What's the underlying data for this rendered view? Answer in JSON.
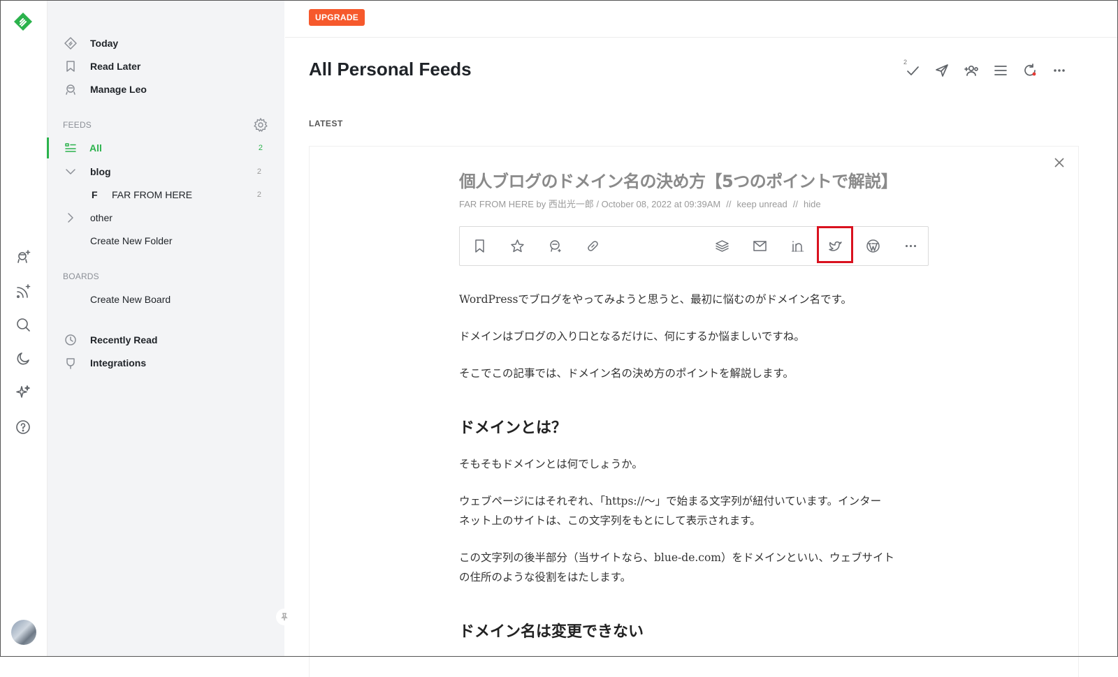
{
  "rail": {
    "icons": [
      "feedly-logo-icon",
      "add-source-icon",
      "add-feed-icon",
      "search-icon",
      "dark-mode-icon",
      "leo-sparkle-icon",
      "help-icon"
    ]
  },
  "sidebar": {
    "top": [
      {
        "label": "Today",
        "icon": "today-icon"
      },
      {
        "label": "Read Later",
        "icon": "bookmark-icon"
      },
      {
        "label": "Manage Leo",
        "icon": "leo-icon"
      }
    ],
    "feeds_heading": "FEEDS",
    "feeds": [
      {
        "label": "All",
        "count": "2"
      },
      {
        "label": "blog",
        "count": "2"
      },
      {
        "letter": "F",
        "label": "FAR FROM HERE",
        "count": "2"
      },
      {
        "label": "other"
      },
      {
        "label": "Create New Folder"
      }
    ],
    "boards_heading": "BOARDS",
    "boards": [
      {
        "label": "Create New Board"
      }
    ],
    "bottom": [
      {
        "label": "Recently Read",
        "icon": "clock-icon"
      },
      {
        "label": "Integrations",
        "icon": "plug-icon"
      }
    ]
  },
  "header": {
    "upgrade": "UPGRADE",
    "title": "All Personal Feeds",
    "mark_read_count": "2",
    "section": "LATEST"
  },
  "article": {
    "title": "個人ブログのドメイン名の決め方【5つのポイントで解説】",
    "meta": {
      "source": "FAR FROM HERE by 西出光一郎 / October 08, 2022 at 09:39AM",
      "sep": "//",
      "keep_unread": "keep unread",
      "hide": "hide"
    },
    "share_icons": [
      "bookmark-icon",
      "star-icon",
      "leo-prioritize-icon",
      "link-icon",
      "buffer-icon",
      "email-icon",
      "linkedin-icon",
      "twitter-icon",
      "wordpress-icon",
      "more-icon"
    ],
    "paragraphs": [
      "WordPressでブログをやってみようと思うと、最初に悩むのがドメイン名です。",
      "ドメインはブログの入り口となるだけに、何にするか悩ましいですね。",
      "そこでこの記事では、ドメイン名の決め方のポイントを解説します。"
    ],
    "h1": "ドメインとは？",
    "paragraphs2": [
      "そもそもドメインとは何でしょうか。",
      "ウェブページにはそれぞれ、「https://〜」で始まる文字列が紐付いています。インター",
      "ネット上のサイトは、この文字列をもとにして表示されます。",
      "この文字列の後半部分（当サイトなら、blue-de.com）をドメインといい、ウェブサイト",
      "の住所のような役割をはたします。"
    ],
    "h2": "ドメイン名は変更できない"
  },
  "colors": {
    "accent": "#2bb24c",
    "upgrade": "#f6592c",
    "highlight": "#d9121f"
  }
}
